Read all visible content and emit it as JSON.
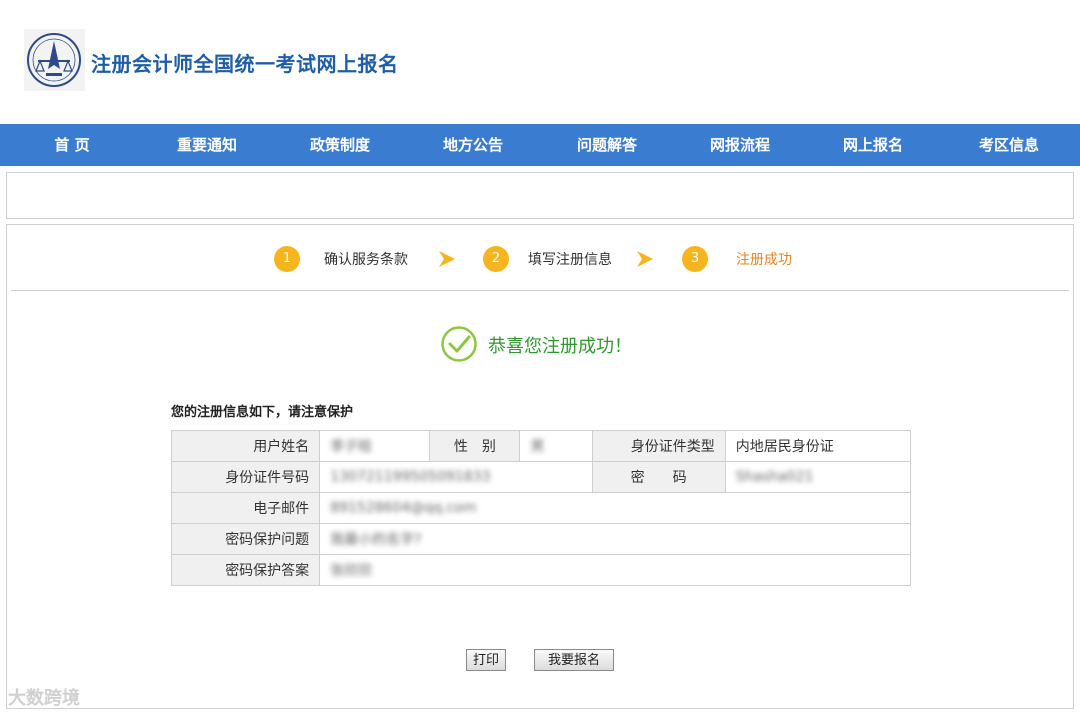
{
  "header": {
    "site_title": "注册会计师全国统一考试网上报名",
    "logo_icon": "cicpa-emblem-icon"
  },
  "nav": {
    "items": [
      {
        "label": "首 页"
      },
      {
        "label": "重要通知"
      },
      {
        "label": "政策制度"
      },
      {
        "label": "地方公告"
      },
      {
        "label": "问题解答"
      },
      {
        "label": "网报流程"
      },
      {
        "label": "网上报名"
      },
      {
        "label": "考区信息"
      }
    ]
  },
  "steps": [
    {
      "number": "1",
      "label": "确认服务条款"
    },
    {
      "number": "2",
      "label": "填写注册信息"
    },
    {
      "number": "3",
      "label": "注册成功"
    }
  ],
  "success": {
    "message": "恭喜您注册成功！"
  },
  "info": {
    "heading": "您的注册信息如下，请注意保护",
    "labels": {
      "name": "用户姓名",
      "gender": "性　别",
      "id_type": "身份证件类型",
      "id_number": "身份证件号码",
      "password": "密　　码",
      "email": "电子邮件",
      "question": "密码保护问题",
      "answer": "密码保护答案"
    },
    "values": {
      "name": "李子晗",
      "gender": "男",
      "id_type": "内地居民身份证",
      "id_number": "130721199505091833",
      "password": "Shasha021",
      "email": "891528604@qq.com",
      "question": "我最小的名字?",
      "answer": "张欣欣"
    }
  },
  "buttons": {
    "print": "打印",
    "apply": "我要报名"
  },
  "watermark": "大数跨境",
  "colors": {
    "nav_bg": "#3a7cd0",
    "title": "#1e5ea8",
    "step_circle": "#f7b51d",
    "step_active": "#e8851f",
    "success": "#2e9a2e"
  }
}
